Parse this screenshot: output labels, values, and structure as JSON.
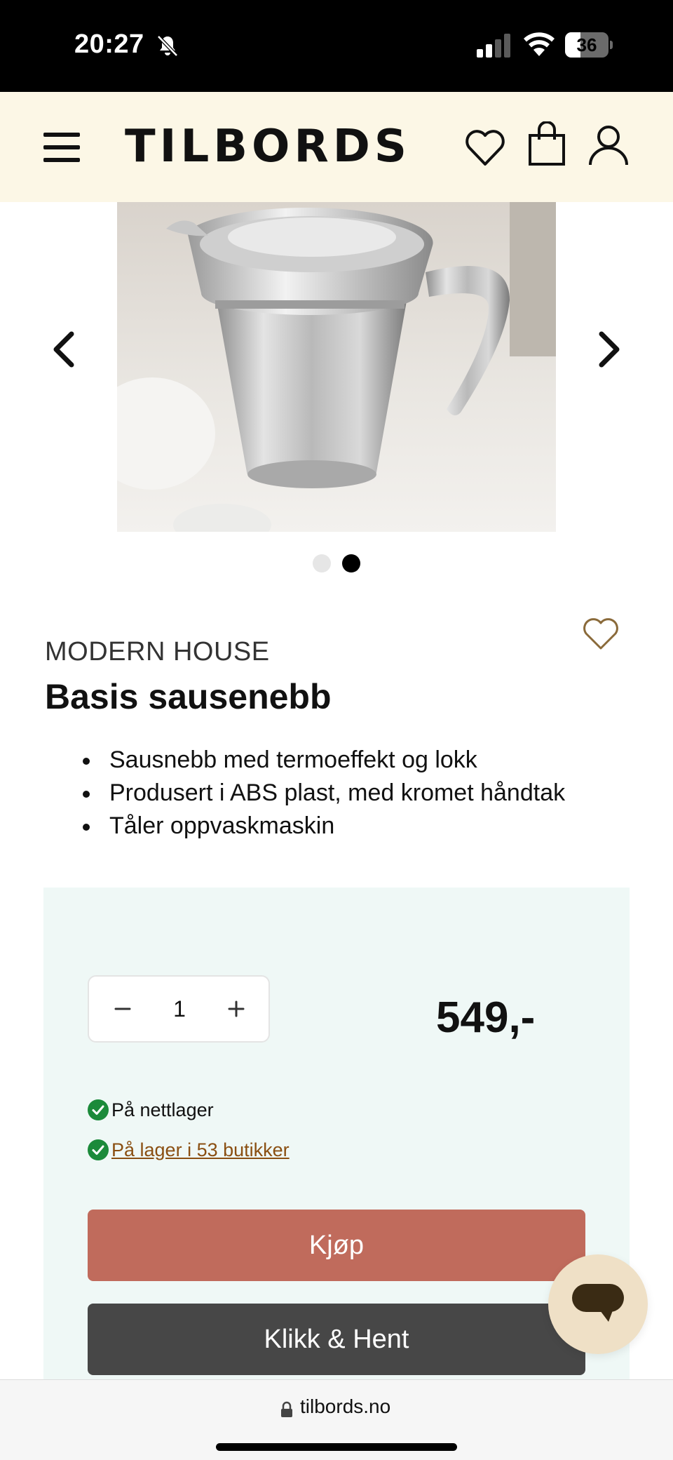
{
  "status_bar": {
    "time": "20:27",
    "battery_level": "36",
    "battery_fraction": 0.36
  },
  "header": {
    "logo_text": "TILBORDS",
    "icons": [
      "menu-icon",
      "heart-icon",
      "shopping-bag-icon",
      "user-icon"
    ]
  },
  "gallery": {
    "current_slide": 2,
    "total_slides": 2,
    "icons": [
      "chevron-left-icon",
      "chevron-right-icon"
    ]
  },
  "product": {
    "brand": "MODERN HOUSE",
    "title": "Basis sausenebb",
    "features": [
      "Sausnebb med termoeffekt og lokk",
      "Produsert i ABS plast, med kromet håndtak",
      "Tåler oppvaskmaskin"
    ]
  },
  "purchase": {
    "quantity": "1",
    "price": "549,-",
    "stock_online": "På nettlager",
    "stock_stores": "På lager i 53 butikker",
    "buy_label": "Kjøp",
    "click_collect_label": "Klikk & Hent"
  },
  "colors": {
    "header_bg": "#fcf7e6",
    "panel_bg": "#eff8f6",
    "buy_button": "#c06b5c",
    "click_collect_button": "#474747",
    "stock_check": "#1b8a3a",
    "stock_link": "#8a4f12",
    "chat_bubble": "#efe0c6",
    "wishlist_icon": "#8a6a3a"
  },
  "browser": {
    "url": "tilbords.no"
  }
}
